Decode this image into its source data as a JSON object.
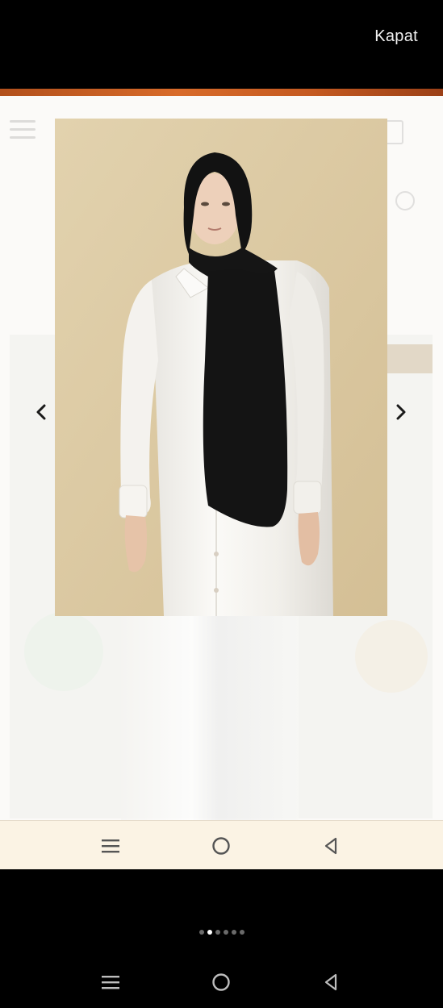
{
  "overlay": {
    "close_label": "Kapat"
  },
  "gallery": {
    "total_slides": 6,
    "active_slide": 2
  },
  "colors": {
    "overlay_bg": "#000000",
    "accent_orange": "#c55a21",
    "photo_bg": "#dcc9a2",
    "nav_bar_bg": "#fbf3e4"
  },
  "icons": {
    "prev": "chevron-left-icon",
    "next": "chevron-right-icon",
    "menu": "menu-icon",
    "home": "home-circle-icon",
    "back": "back-triangle-icon"
  }
}
